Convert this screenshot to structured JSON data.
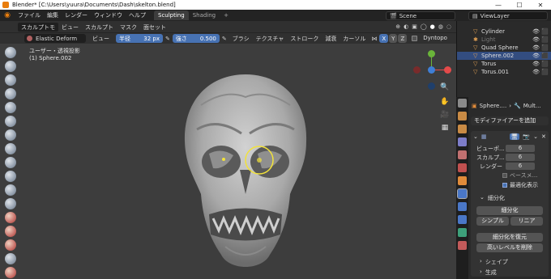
{
  "window": {
    "title": "Blender* [C:\\Users\\yuura\\Documents\\Dash\\skelton.blend]"
  },
  "menu": {
    "items": [
      "ファイル",
      "編集",
      "レンダー",
      "ウィンドウ",
      "ヘルプ"
    ],
    "workspaces": [
      "Sculpting",
      "Shading"
    ],
    "add_tab": "+",
    "scene": "Scene",
    "viewlayer": "ViewLayer"
  },
  "header": {
    "mode": "スカルプトモ",
    "menus": [
      "ビュー",
      "スカルプト",
      "マスク",
      "面セット"
    ],
    "radius_label": "半径",
    "radius_value": "32 px",
    "strength_label": "強さ",
    "strength_value": "0.500",
    "dropdowns": [
      "ブラシ",
      "テクスチャ",
      "ストローク",
      "減衰",
      "カーソル"
    ],
    "axes": [
      "X",
      "Y",
      "Z"
    ],
    "dyntopo": "Dyntopo"
  },
  "tool_settings": {
    "brush": "Elastic Deform"
  },
  "viewport": {
    "view_label": "ユーザー・透視投影",
    "object_label": "(1) Sphere.002"
  },
  "outliner": {
    "items": [
      {
        "name": "Cylinder",
        "dim": false,
        "selected": false
      },
      {
        "name": "Light",
        "dim": true,
        "selected": false
      },
      {
        "name": "Quad Sphere",
        "dim": false,
        "selected": false
      },
      {
        "name": "Sphere.002",
        "dim": false,
        "selected": true
      },
      {
        "name": "Torus",
        "dim": false,
        "selected": false
      },
      {
        "name": "Torus.001",
        "dim": false,
        "selected": false
      }
    ]
  },
  "properties": {
    "breadcrumb_object": "Sphere....",
    "breadcrumb_mod": "Mult...",
    "add_modifier": "モディファイアーを追加",
    "viewport_label": "ビューポ...",
    "viewport_value": "6",
    "sculpt_label": "スカルプ...",
    "sculpt_value": "6",
    "render_label": "レンダー",
    "render_value": "6",
    "base_mesh": "ベースメ...",
    "optimal_display": "最適化表示",
    "subdivide_section": "細分化",
    "subdivide_btn": "細分化",
    "simple_btn": "シンプル",
    "linear_btn": "リニア",
    "unsubdivide_btn": "細分化を復元",
    "delete_higher_btn": "高いレベルを削除",
    "shape_section": "シェイプ",
    "generate_section": "生成"
  },
  "colors": {
    "accent_blue": "#4772b3",
    "brush_cursor": "#f2e23a",
    "selected_row": "#334d80",
    "gizmo_x": "#e44a4a",
    "gizmo_y": "#6ab43a",
    "gizmo_z": "#3f7fd6"
  }
}
